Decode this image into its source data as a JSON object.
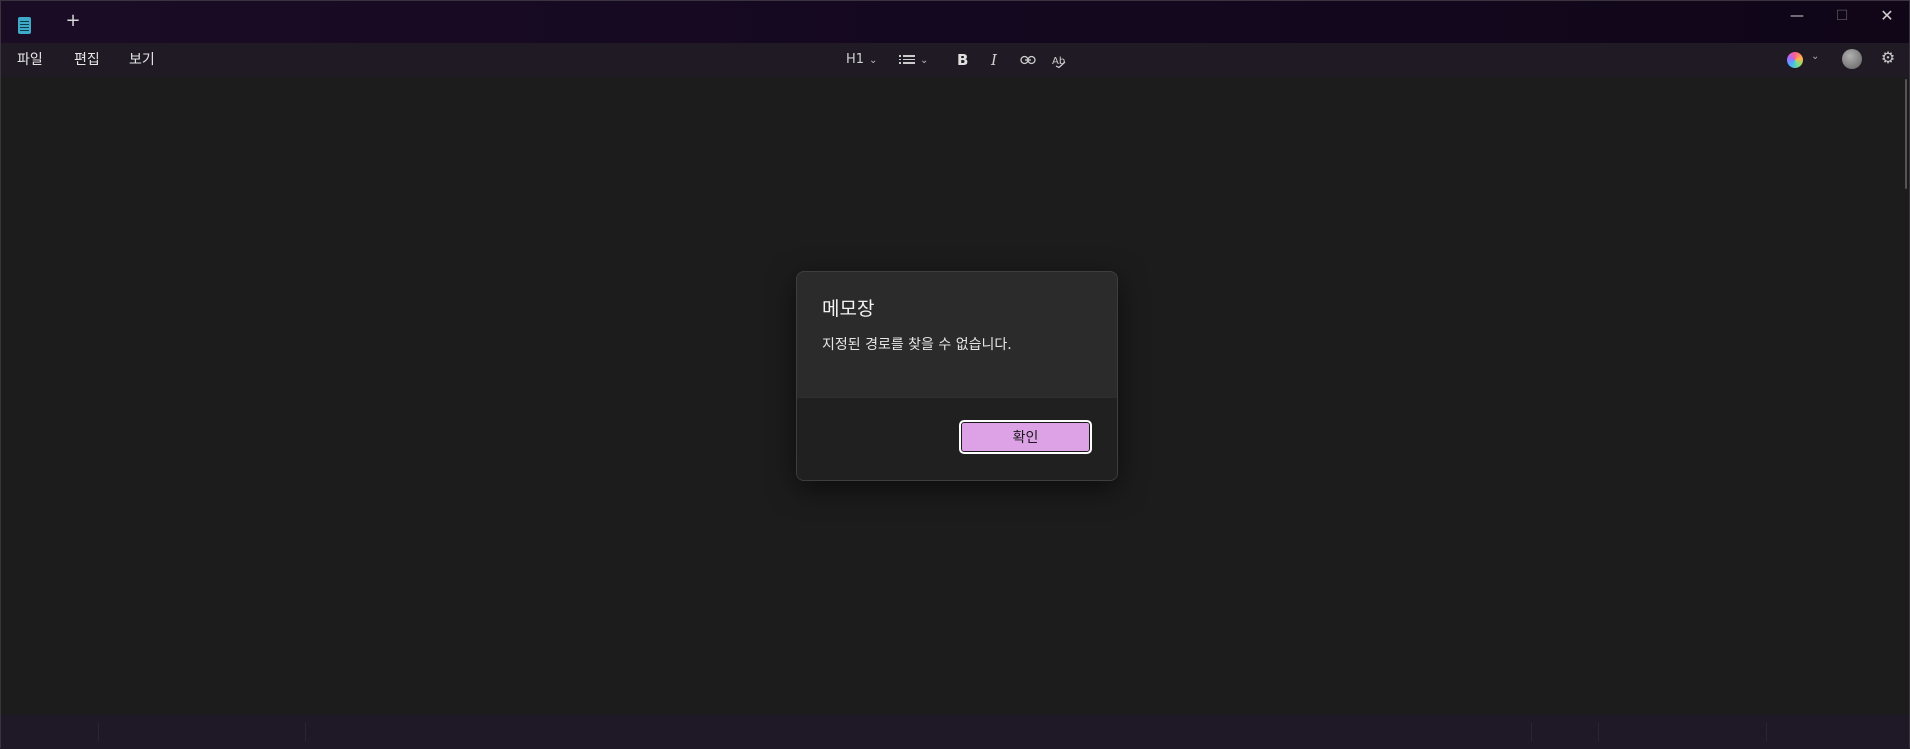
{
  "titlebar": {
    "app_icon": "notepad-icon",
    "new_tab_label": "+",
    "minimize_glyph": "—",
    "maximize_glyph": "☐",
    "close_glyph": "✕"
  },
  "menu": {
    "file": "파일",
    "edit": "편집",
    "view": "보기"
  },
  "toolbar": {
    "heading": "H1",
    "heading_chevron": "⌄",
    "list_chevron": "⌄",
    "bold": "B",
    "italic": "I",
    "link_glyph": "⊖",
    "spellcheck": "A͟b"
  },
  "right_tools": {
    "copilot_chevron": "⌄",
    "settings_glyph": "⚙"
  },
  "dialog": {
    "title": "메모장",
    "message": "지정된 경로를 찾을 수 없습니다.",
    "ok_label": "확인"
  },
  "colors": {
    "accent_button": "#dda1e6",
    "titlebar": "#1a0c24",
    "editor_background": "#1c1c1c"
  }
}
